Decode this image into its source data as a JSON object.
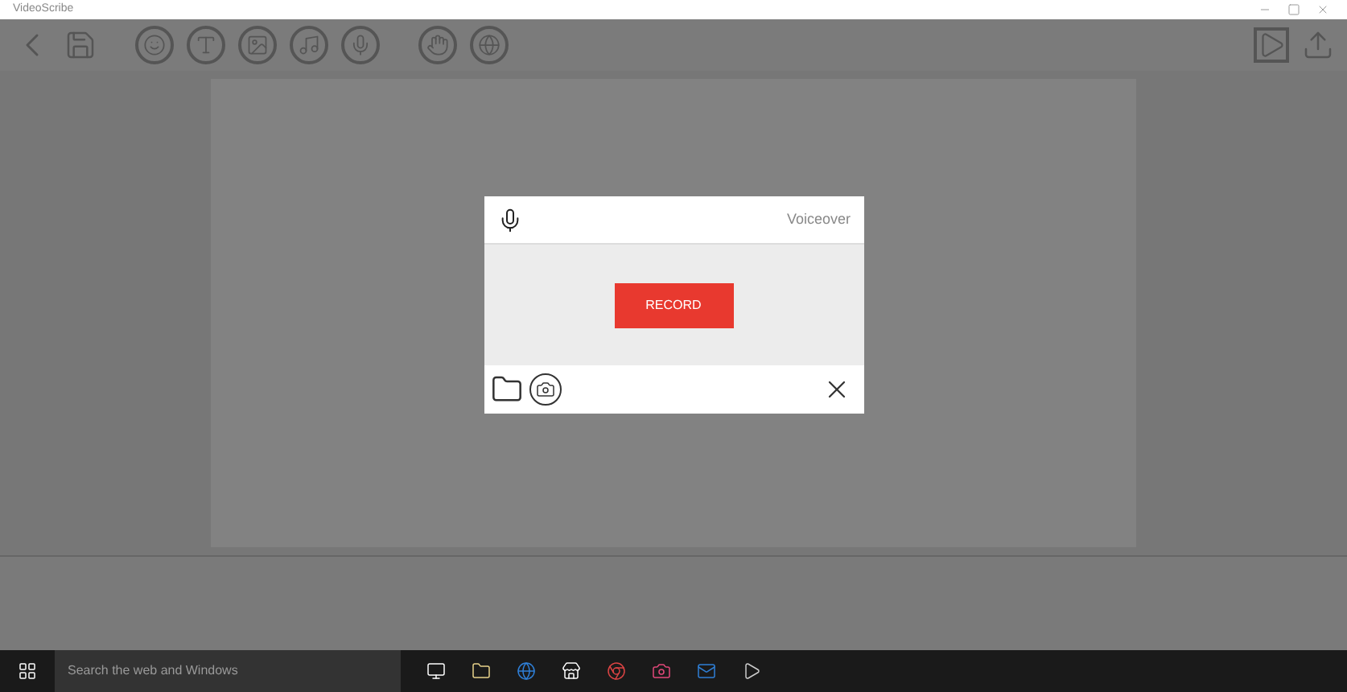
{
  "window": {
    "title": "VideoScribe"
  },
  "dialog": {
    "title": "Voiceover",
    "record_button": "RECORD"
  },
  "taskbar": {
    "search_placeholder": "Search the web and Windows"
  }
}
